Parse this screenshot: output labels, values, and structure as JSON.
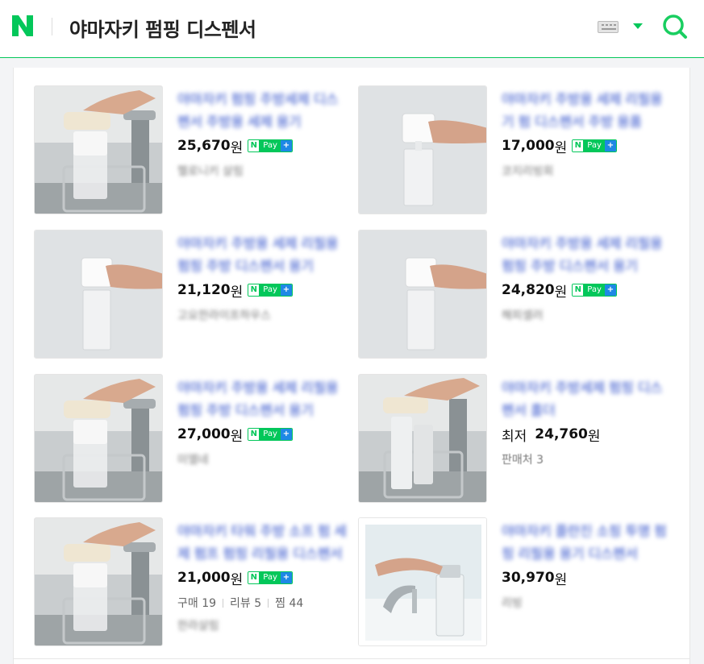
{
  "header": {
    "title": "야마자키 펌핑 디스펜서",
    "logo_letter": "N",
    "keyboard_icon": "keyboard-icon",
    "search_icon": "search-icon"
  },
  "npay": {
    "n": "N",
    "pay": "Pay",
    "plus": "+"
  },
  "products": [
    {
      "name": "야마자키 펌핑 주방세제 디스펜서 주방용 세제 용기",
      "price": "25,670",
      "won": "원",
      "seller": "헬로니키 살림"
    },
    {
      "name": "야마자키 주방용 세제 리필용기 펌 디스펜서 주방 용품",
      "price": "17,000",
      "won": "원",
      "seller": "코지리빙회"
    },
    {
      "name": "야마자키 주방용 세제 리필용 펌핑 주방 디스펜서 용기",
      "price": "21,120",
      "won": "원",
      "seller": "고요한라이프하우스"
    },
    {
      "name": "야마자키 주방용 세제 리필용 펌핑 주방 디스펜서 용기",
      "price": "24,820",
      "won": "원",
      "seller": "해피셀러"
    },
    {
      "name": "야마자키 주방용 세제 리필용 펌핑 주방 디스펜서 용기",
      "price": "27,000",
      "won": "원",
      "seller": "미엘네"
    },
    {
      "name": "야마자키 주방세제 펌핑 디스펜서 홀더",
      "low_label": "최저",
      "price": "24,760",
      "won": "원",
      "seller": "판매처 3"
    },
    {
      "name": "야마자키 타워 주방 소프 펌 세제 펌프 펌핑 리필용 디스펜서",
      "price": "21,000",
      "won": "원",
      "stats": {
        "buy": "구매 19",
        "review": "리뷰 5",
        "wish": "찜 44"
      },
      "seller": "한라살림"
    },
    {
      "name": "야마자키 플란진 소핑 투명 펌핑 리필용 용기 디스펜서",
      "price": "30,970",
      "won": "원",
      "seller": "리빙"
    }
  ]
}
